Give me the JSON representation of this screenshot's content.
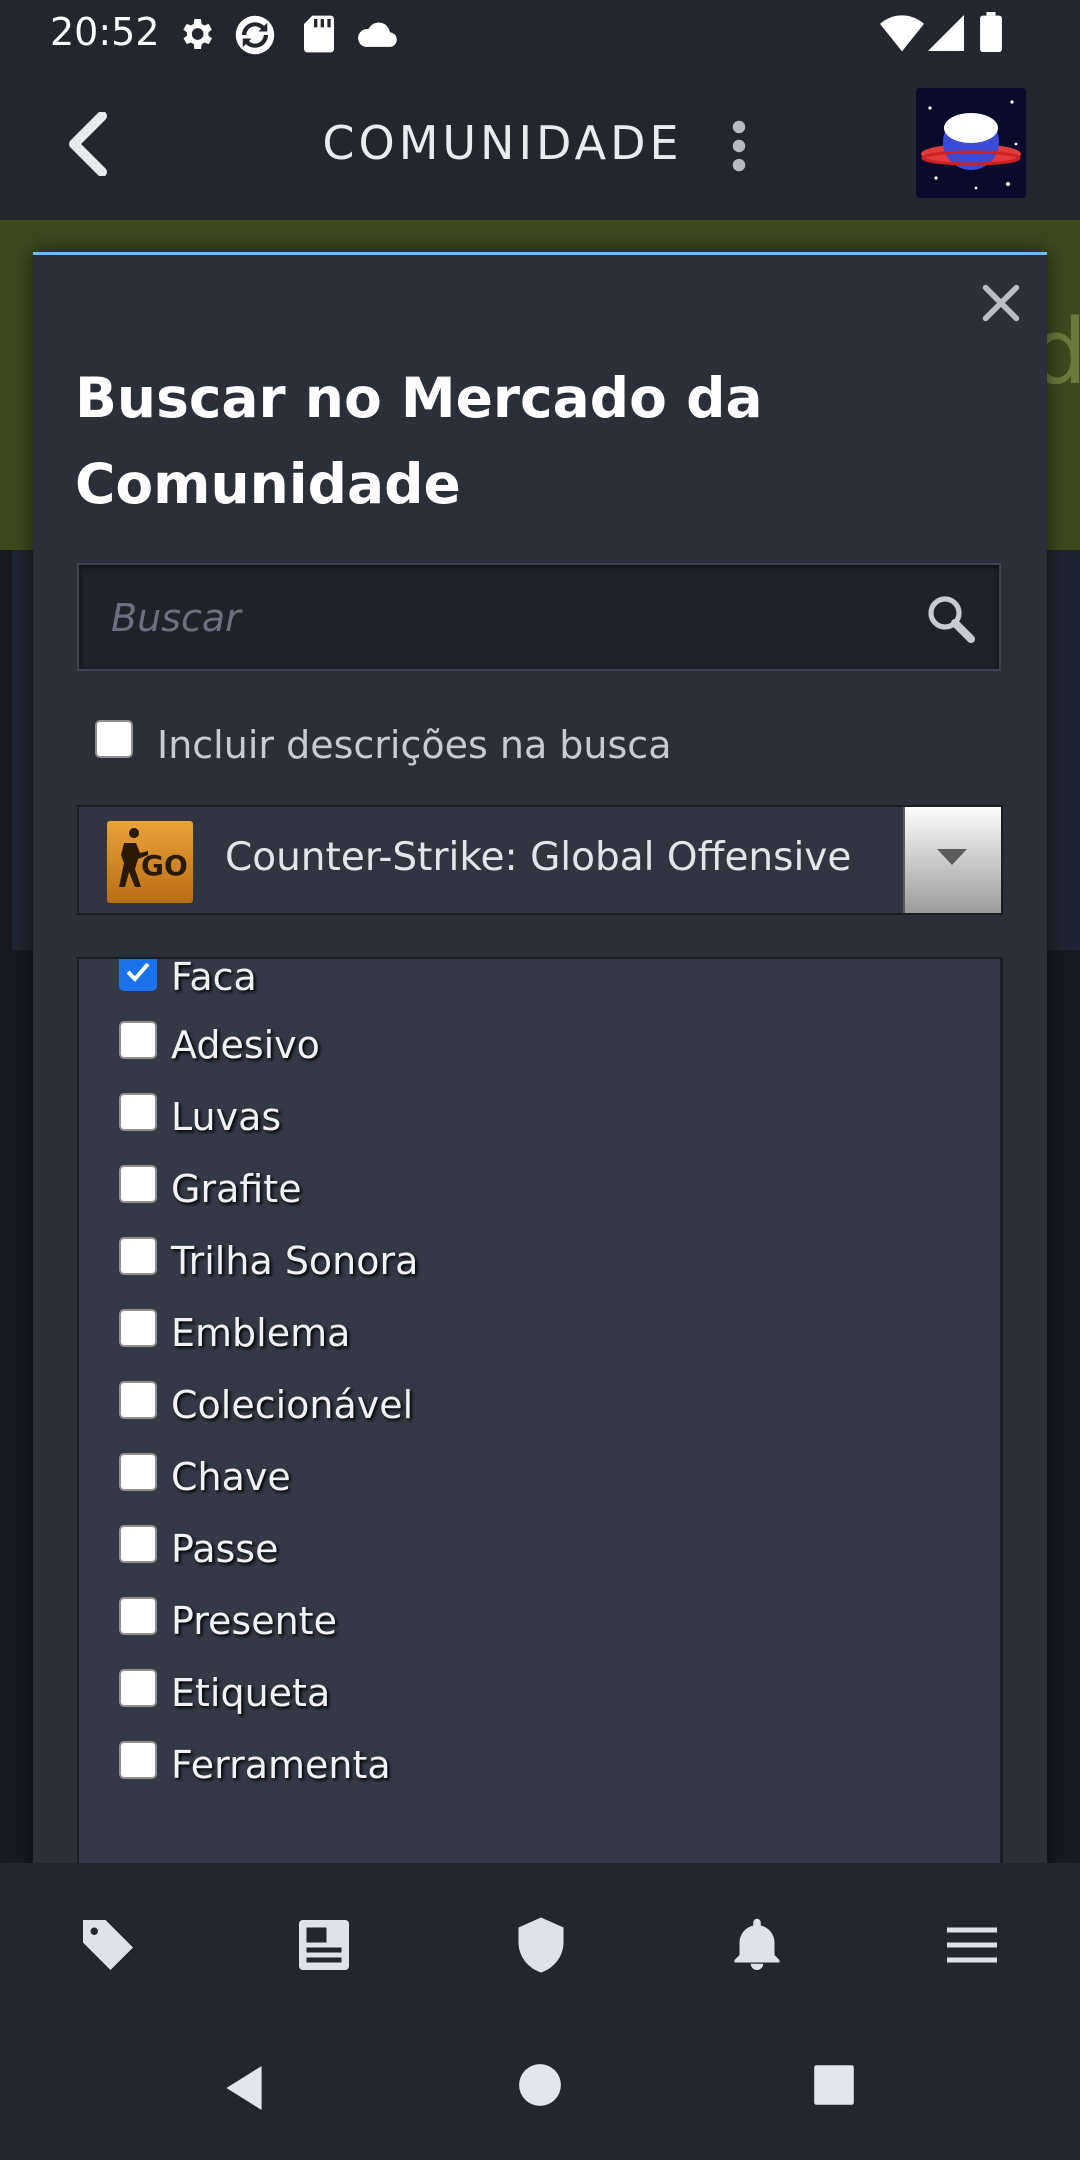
{
  "status_bar": {
    "time": "20:52",
    "left_icons": [
      "settings-icon",
      "sync-icon",
      "sd-card-icon",
      "cloud-icon"
    ],
    "right_icons": [
      "wifi-icon",
      "signal-icon",
      "battery-icon"
    ]
  },
  "app_bar": {
    "title": "COMUNIDADE",
    "back_icon": "chevron-left-icon",
    "more_icon": "more-vert-icon"
  },
  "background_page": {
    "ghost_text": "d"
  },
  "modal": {
    "title": "Buscar no Mercado da Comunidade",
    "search": {
      "placeholder": "Buscar",
      "value": ""
    },
    "include_descriptions": {
      "label": "Incluir descrições na busca",
      "checked": false
    },
    "game_select": {
      "selected": "Counter-Strike: Global Offensive",
      "logo_text": "GO"
    },
    "item_types": [
      {
        "label": "Faca",
        "checked": true
      },
      {
        "label": "Adesivo",
        "checked": false
      },
      {
        "label": "Luvas",
        "checked": false
      },
      {
        "label": "Grafite",
        "checked": false
      },
      {
        "label": "Trilha Sonora",
        "checked": false
      },
      {
        "label": "Emblema",
        "checked": false
      },
      {
        "label": "Colecionável",
        "checked": false
      },
      {
        "label": "Chave",
        "checked": false
      },
      {
        "label": "Passe",
        "checked": false
      },
      {
        "label": "Presente",
        "checked": false
      },
      {
        "label": "Etiqueta",
        "checked": false
      },
      {
        "label": "Ferramenta",
        "checked": false
      }
    ]
  },
  "bottom_nav": [
    "tag-icon",
    "news-icon",
    "shield-icon",
    "bell-icon",
    "menu-icon"
  ],
  "system_nav": [
    "back-triangle-icon",
    "home-circle-icon",
    "recents-square-icon"
  ],
  "colors": {
    "accent": "#66c0f4",
    "checkbox_checked": "#1a73e8",
    "modal_bg": "#2a2f3a"
  }
}
